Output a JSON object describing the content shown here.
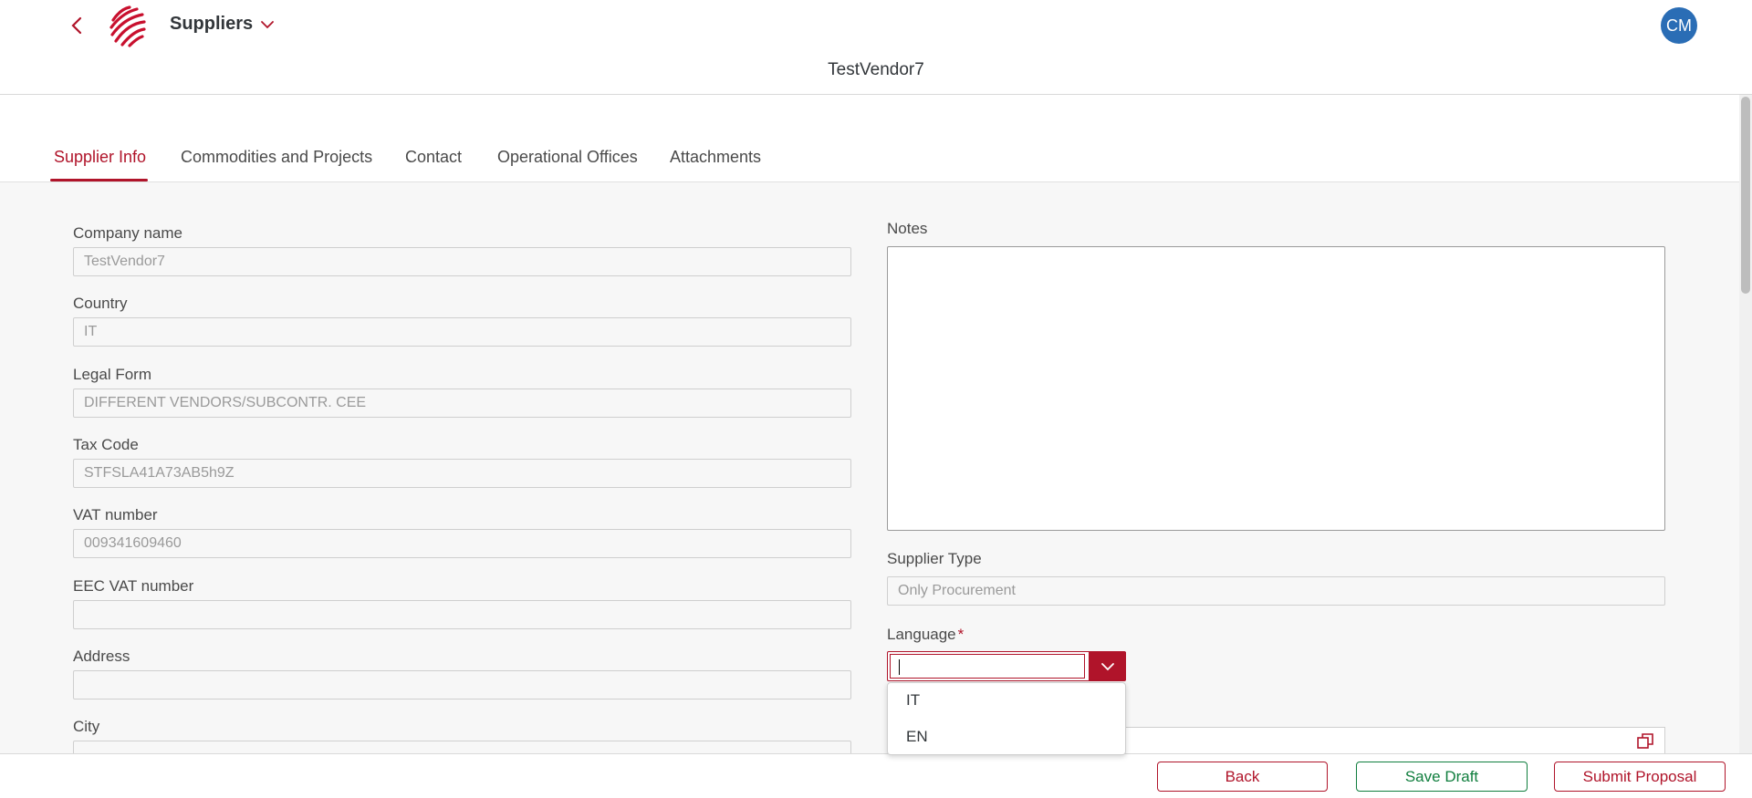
{
  "shellbar": {
    "app_title": "Suppliers",
    "user_initials": "CM",
    "object_title": "TestVendor7"
  },
  "tabs": [
    {
      "label": "Supplier Info"
    },
    {
      "label": "Commodities and Projects"
    },
    {
      "label": "Contact"
    },
    {
      "label": "Operational Offices"
    },
    {
      "label": "Attachments"
    }
  ],
  "form": {
    "company_name": {
      "label": "Company name",
      "value": "TestVendor7"
    },
    "country": {
      "label": "Country",
      "value": "IT"
    },
    "legal_form": {
      "label": "Legal Form",
      "value": "DIFFERENT VENDORS/SUBCONTR. CEE"
    },
    "tax_code": {
      "label": "Tax Code",
      "value": "STFSLA41A73AB5h9Z"
    },
    "vat_number": {
      "label": "VAT number",
      "value": "009341609460"
    },
    "eec_vat_number": {
      "label": "EEC VAT number",
      "value": ""
    },
    "address": {
      "label": "Address",
      "value": ""
    },
    "city": {
      "label": "City",
      "value": ""
    },
    "notes": {
      "label": "Notes",
      "value": ""
    },
    "supplier_type": {
      "label": "Supplier Type",
      "value": "Only Procurement"
    },
    "language": {
      "label": "Language",
      "required_mark": "*",
      "value": "",
      "options": [
        "IT",
        "EN"
      ]
    }
  },
  "footer": {
    "back_label": "Back",
    "save_draft_label": "Save Draft",
    "submit_label": "Submit Proposal"
  },
  "colors": {
    "accent": "#b0142a",
    "positive": "#107e3e",
    "avatar": "#2a6db5"
  },
  "icons": [
    "chevron-left-icon",
    "company-logo",
    "chevron-down-icon",
    "copy-icon"
  ]
}
